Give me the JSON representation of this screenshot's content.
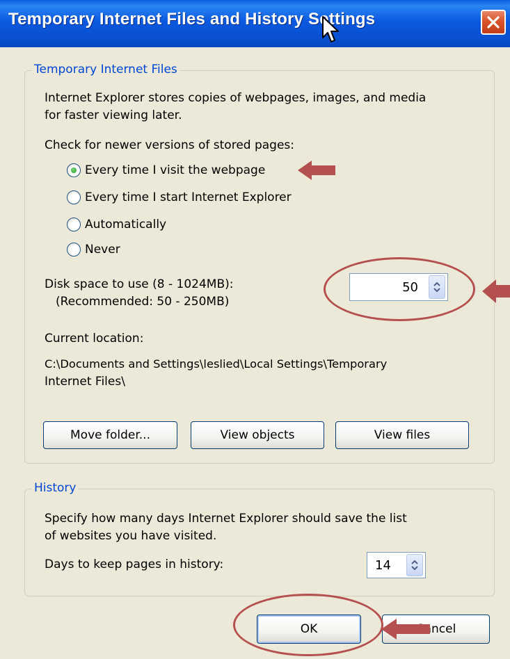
{
  "dialog": {
    "title": "Temporary Internet Files and History Settings",
    "close_icon": "close-icon"
  },
  "temp_files": {
    "legend": "Temporary Internet Files",
    "description_line1": "Internet Explorer stores copies of webpages, images, and media",
    "description_line2": "for faster viewing later.",
    "check_label": "Check for newer versions of stored pages:",
    "options": [
      {
        "label": "Every time I visit the webpage",
        "checked": true
      },
      {
        "label": "Every time I start Internet Explorer",
        "checked": false
      },
      {
        "label": "Automatically",
        "checked": false
      },
      {
        "label": "Never",
        "checked": false
      }
    ],
    "disk_space_label": "Disk space to use (8 - 1024MB):",
    "disk_space_recommended": "(Recommended: 50 - 250MB)",
    "disk_space_value": "50",
    "current_location_label": "Current location:",
    "current_location_line1": "C:\\Documents and Settings\\leslied\\Local Settings\\Temporary",
    "current_location_line2": "Internet Files\\",
    "buttons": {
      "move_folder": "Move folder...",
      "view_objects": "View objects",
      "view_files": "View files"
    }
  },
  "history": {
    "legend": "History",
    "description_line1": "Specify how many days Internet Explorer should save the list",
    "description_line2": "of websites you have visited.",
    "days_label": "Days to keep pages in history:",
    "days_value": "14"
  },
  "footer": {
    "ok_label": "OK",
    "cancel_label": "Cancel"
  },
  "colors": {
    "titlebar": "#0a5fe0",
    "dialog_bg": "#ece9d8",
    "legend_text": "#0046d5",
    "annotation": "#b55050"
  }
}
